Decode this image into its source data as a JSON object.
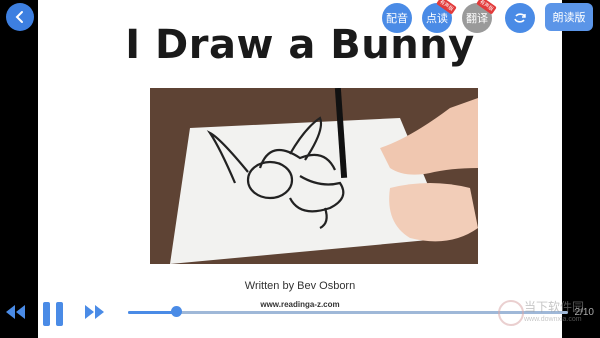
{
  "toolbar": {
    "peiyin": "配音",
    "diandu": "点读",
    "fanyi": "翻译",
    "langdu": "朗读版",
    "badge": "有声版"
  },
  "book": {
    "title": "I Draw a Bunny",
    "author": "Written by Bev Osborn",
    "website": "www.readinga-z.com"
  },
  "player": {
    "progress": 0.11,
    "page_indicator": "2/10"
  },
  "watermark": {
    "text": "当下软件园",
    "url": "www.downxia.com"
  }
}
